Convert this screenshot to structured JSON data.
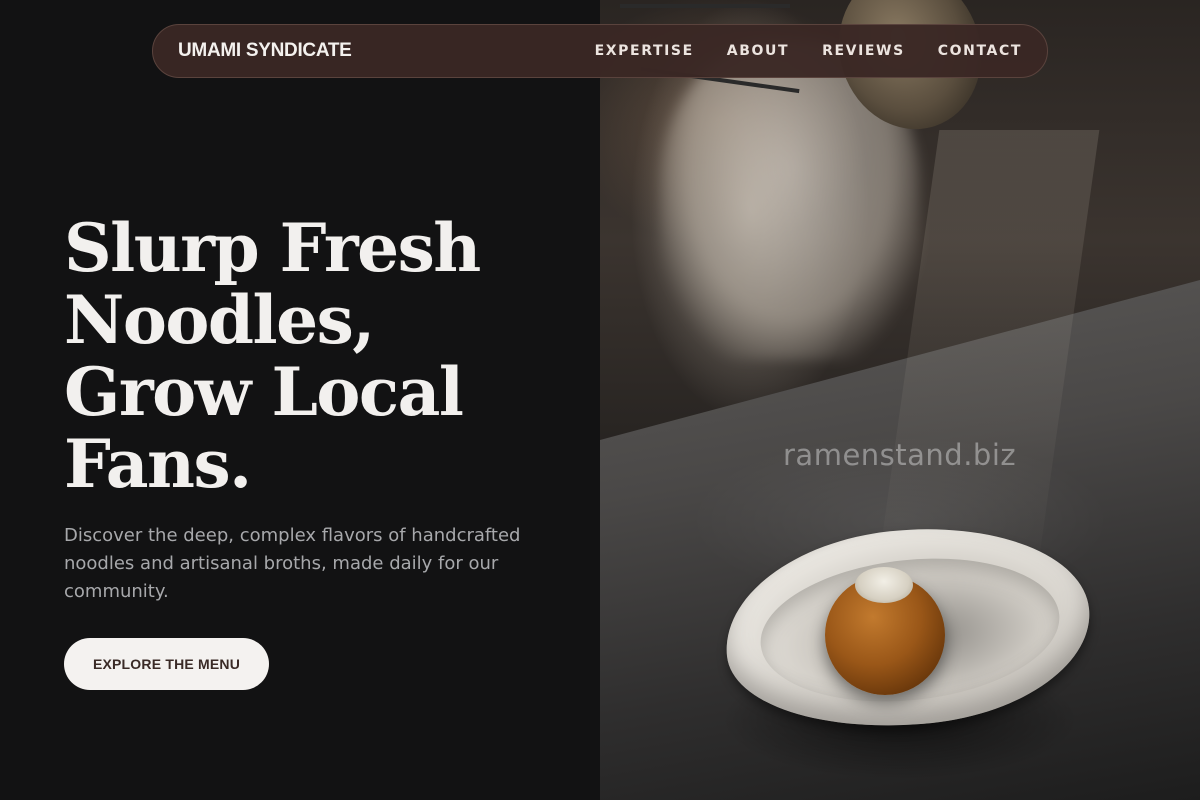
{
  "nav": {
    "brand": "UMAMI SYNDICATE",
    "links": [
      "EXPERTISE",
      "ABOUT",
      "REVIEWS",
      "CONTACT"
    ]
  },
  "hero": {
    "title_lines": [
      "Slurp Fresh",
      "Noodles,",
      "Grow Local",
      "Fans."
    ],
    "subtitle": "Discover the deep, complex flavors of handcrafted noodles and artisanal broths, made daily for our community.",
    "cta_label": "EXPLORE THE MENU"
  },
  "watermark": "ramenstand.biz",
  "colors": {
    "background": "#121213",
    "nav_background": "#3a2824",
    "text_primary": "#f2f0ee",
    "text_muted": "#a7a8ab",
    "cta_background": "#f4f2f0",
    "cta_text": "#3a2a26"
  }
}
